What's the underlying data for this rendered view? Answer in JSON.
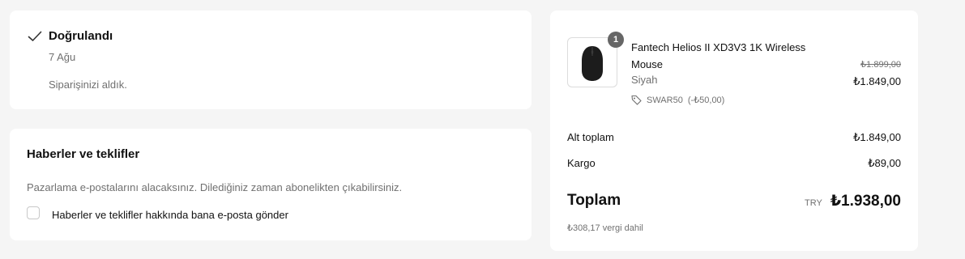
{
  "status": {
    "title": "Doğrulandı",
    "date": "7 Ağu",
    "message": "Siparişinizi aldık."
  },
  "news": {
    "title": "Haberler ve teklifler",
    "description": "Pazarlama e-postalarını alacaksınız. Dilediğiniz zaman abonelikten çıkabilirsiniz.",
    "checkbox_label": "Haberler ve teklifler hakkında bana e-posta gönder",
    "checkbox_checked": false
  },
  "summary": {
    "product": {
      "quantity": "1",
      "name": "Fantech Helios II XD3V3 1K Wireless Mouse",
      "variant": "Siyah",
      "discount_code": "SWAR50",
      "discount_amount": "(-₺50,00)",
      "original_price": "₺1.899,00",
      "price": "₺1.849,00"
    },
    "subtotal_label": "Alt toplam",
    "subtotal_value": "₺1.849,00",
    "shipping_label": "Kargo",
    "shipping_value": "₺89,00",
    "total_label": "Toplam",
    "total_currency": "TRY",
    "total_value": "₺1.938,00",
    "tax_note": "₺308,17 vergi dahil"
  },
  "icons": {
    "status": "check-icon",
    "discount": "tag-icon",
    "product_image": "mouse-image"
  }
}
